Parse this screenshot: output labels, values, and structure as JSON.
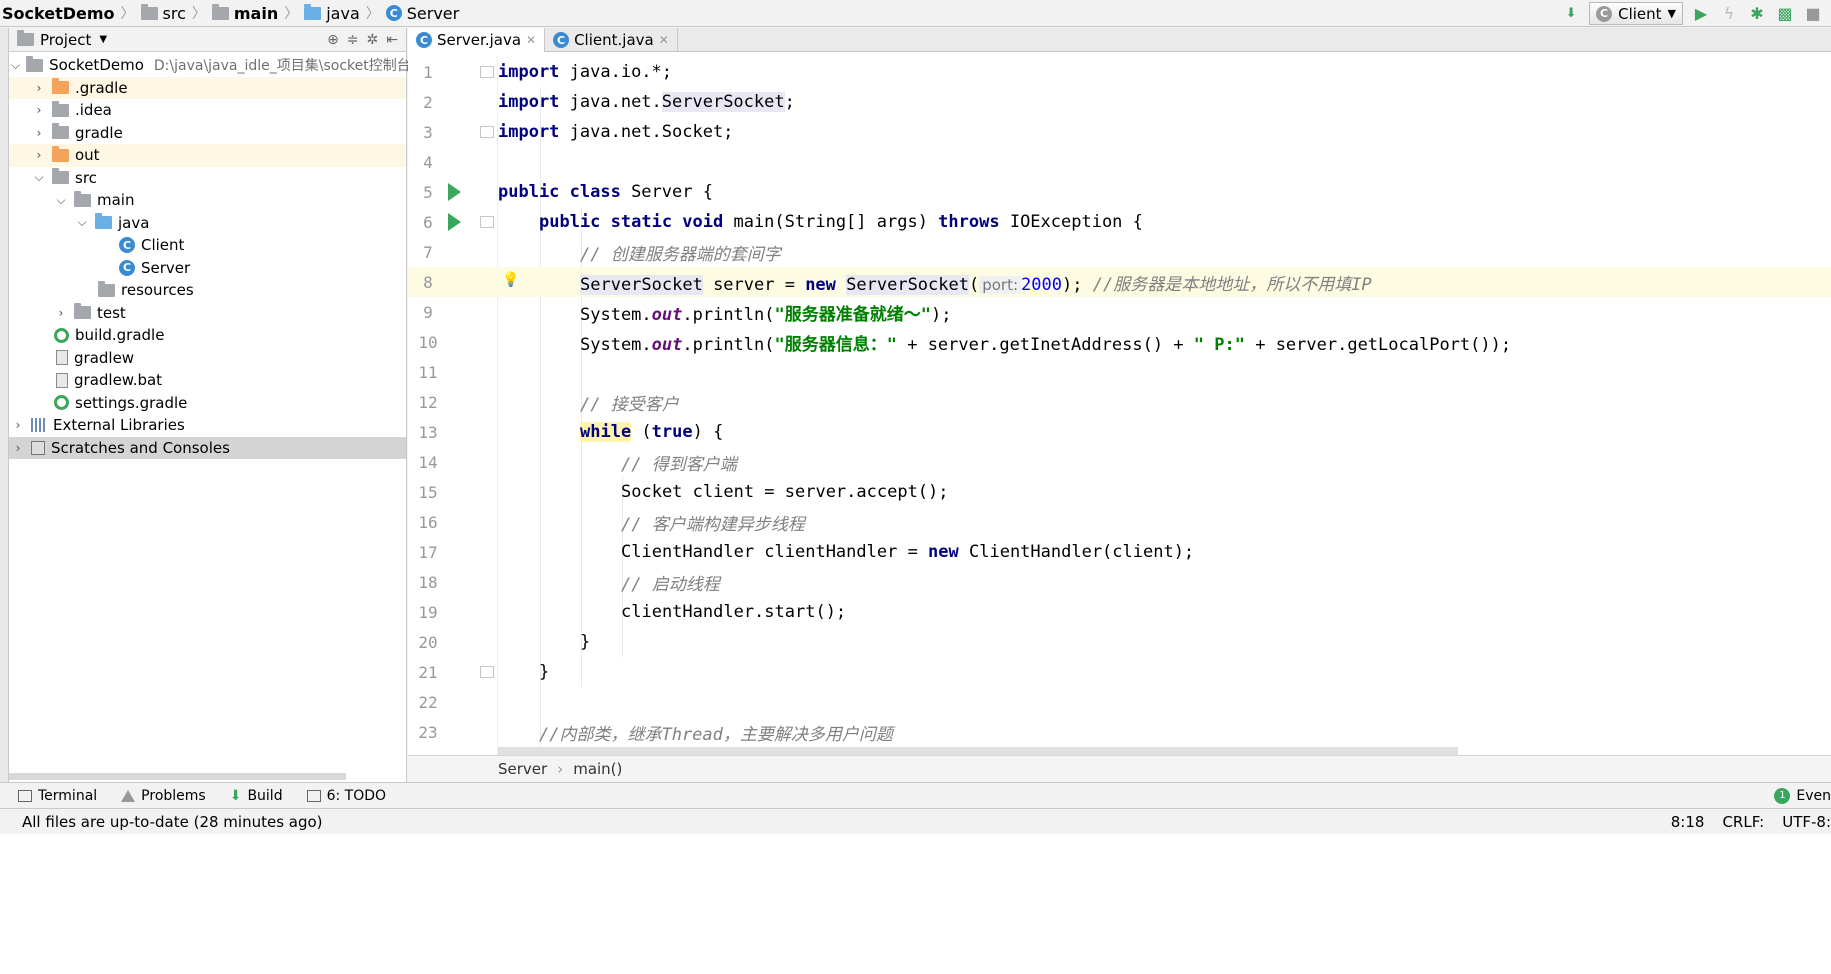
{
  "navbar": {
    "crumbs": [
      {
        "label": "SocketDemo"
      },
      {
        "label": "src"
      },
      {
        "label": "main"
      },
      {
        "label": "java"
      },
      {
        "label": "Server"
      }
    ],
    "run_config": "Client"
  },
  "project": {
    "title": "Project",
    "tree": [
      {
        "label": "SocketDemo",
        "hint": "D:\\java\\java_idle_项目集\\socket控制台C\\S\\S"
      },
      {
        "label": ".gradle"
      },
      {
        "label": ".idea"
      },
      {
        "label": "gradle"
      },
      {
        "label": "out"
      },
      {
        "label": "src"
      },
      {
        "label": "main"
      },
      {
        "label": "java"
      },
      {
        "label": "Client"
      },
      {
        "label": "Server"
      },
      {
        "label": "resources"
      },
      {
        "label": "test"
      },
      {
        "label": "build.gradle"
      },
      {
        "label": "gradlew"
      },
      {
        "label": "gradlew.bat"
      },
      {
        "label": "settings.gradle"
      },
      {
        "label": "External Libraries"
      },
      {
        "label": "Scratches and Consoles"
      }
    ]
  },
  "editor": {
    "tabs": [
      {
        "label": "Server.java"
      },
      {
        "label": "Client.java"
      }
    ],
    "line_numbers": [
      "1",
      "2",
      "3",
      "4",
      "5",
      "6",
      "7",
      "8",
      "9",
      "10",
      "11",
      "12",
      "13",
      "14",
      "15",
      "16",
      "17",
      "18",
      "19",
      "20",
      "21",
      "22",
      "23"
    ],
    "code": {
      "l1_kw": "import",
      "l1_rest": " java.io.*;",
      "l2_kw": "import",
      "l2_a": " java.net.",
      "l2_b": "ServerSocket",
      "l2_c": ";",
      "l3_kw": "import",
      "l3_rest": " java.net.Socket;",
      "l5_kw": "public class",
      "l5_rest": " Server {",
      "l6_kw1": "public static void",
      "l6_a": " main(String[] args) ",
      "l6_kw2": "throws",
      "l6_b": " IOException {",
      "l7_cmt": "// 创建服务器端的套间字",
      "l8_a": "ServerSocket",
      "l8_b": " server = ",
      "l8_kw": "new",
      "l8_c": " ",
      "l8_d": "ServerSocket",
      "l8_e": "(",
      "l8_hint": "port:",
      "l8_num": "2000",
      "l8_f": "); ",
      "l8_cmt": "//服务器是本地地址，所以不用填IP",
      "l9_a": "System.",
      "l9_fld": "out",
      "l9_b": ".println(",
      "l9_str": "\"服务器准备就绪～\"",
      "l9_c": ");",
      "l10_a": "System.",
      "l10_fld": "out",
      "l10_b": ".println(",
      "l10_str1": "\"服务器信息：\"",
      "l10_c": " + server.getInetAddress() + ",
      "l10_str2": "\" P:\"",
      "l10_d": " + server.getLocalPort());",
      "l12_cmt": "// 接受客户",
      "l13_kw": "while",
      "l13_a": " (",
      "l13_kw2": "true",
      "l13_b": ") {",
      "l14_cmt": "// 得到客户端",
      "l15": "Socket client = server.accept();",
      "l16_cmt": "// 客户端构建异步线程",
      "l17_a": "ClientHandler clientHandler = ",
      "l17_kw": "new",
      "l17_b": " ClientHandler(client);",
      "l18_cmt": "// 启动线程",
      "l19": "clientHandler.start();",
      "l20": "}",
      "l21": "}",
      "l23_cmt": "//内部类，继承Thread，主要解决多用户问题"
    },
    "breadcrumb": [
      "Server",
      "main()"
    ]
  },
  "toolwindows": [
    {
      "label": "Terminal"
    },
    {
      "label": "Problems"
    },
    {
      "label": "Build"
    },
    {
      "label": "6: TODO"
    }
  ],
  "event_log": {
    "label": "Even",
    "count": "1"
  },
  "status": {
    "message": "All files are up-to-date (28 minutes ago)",
    "position": "8:18",
    "line_sep": "CRLF:",
    "encoding": "UTF-8:"
  }
}
